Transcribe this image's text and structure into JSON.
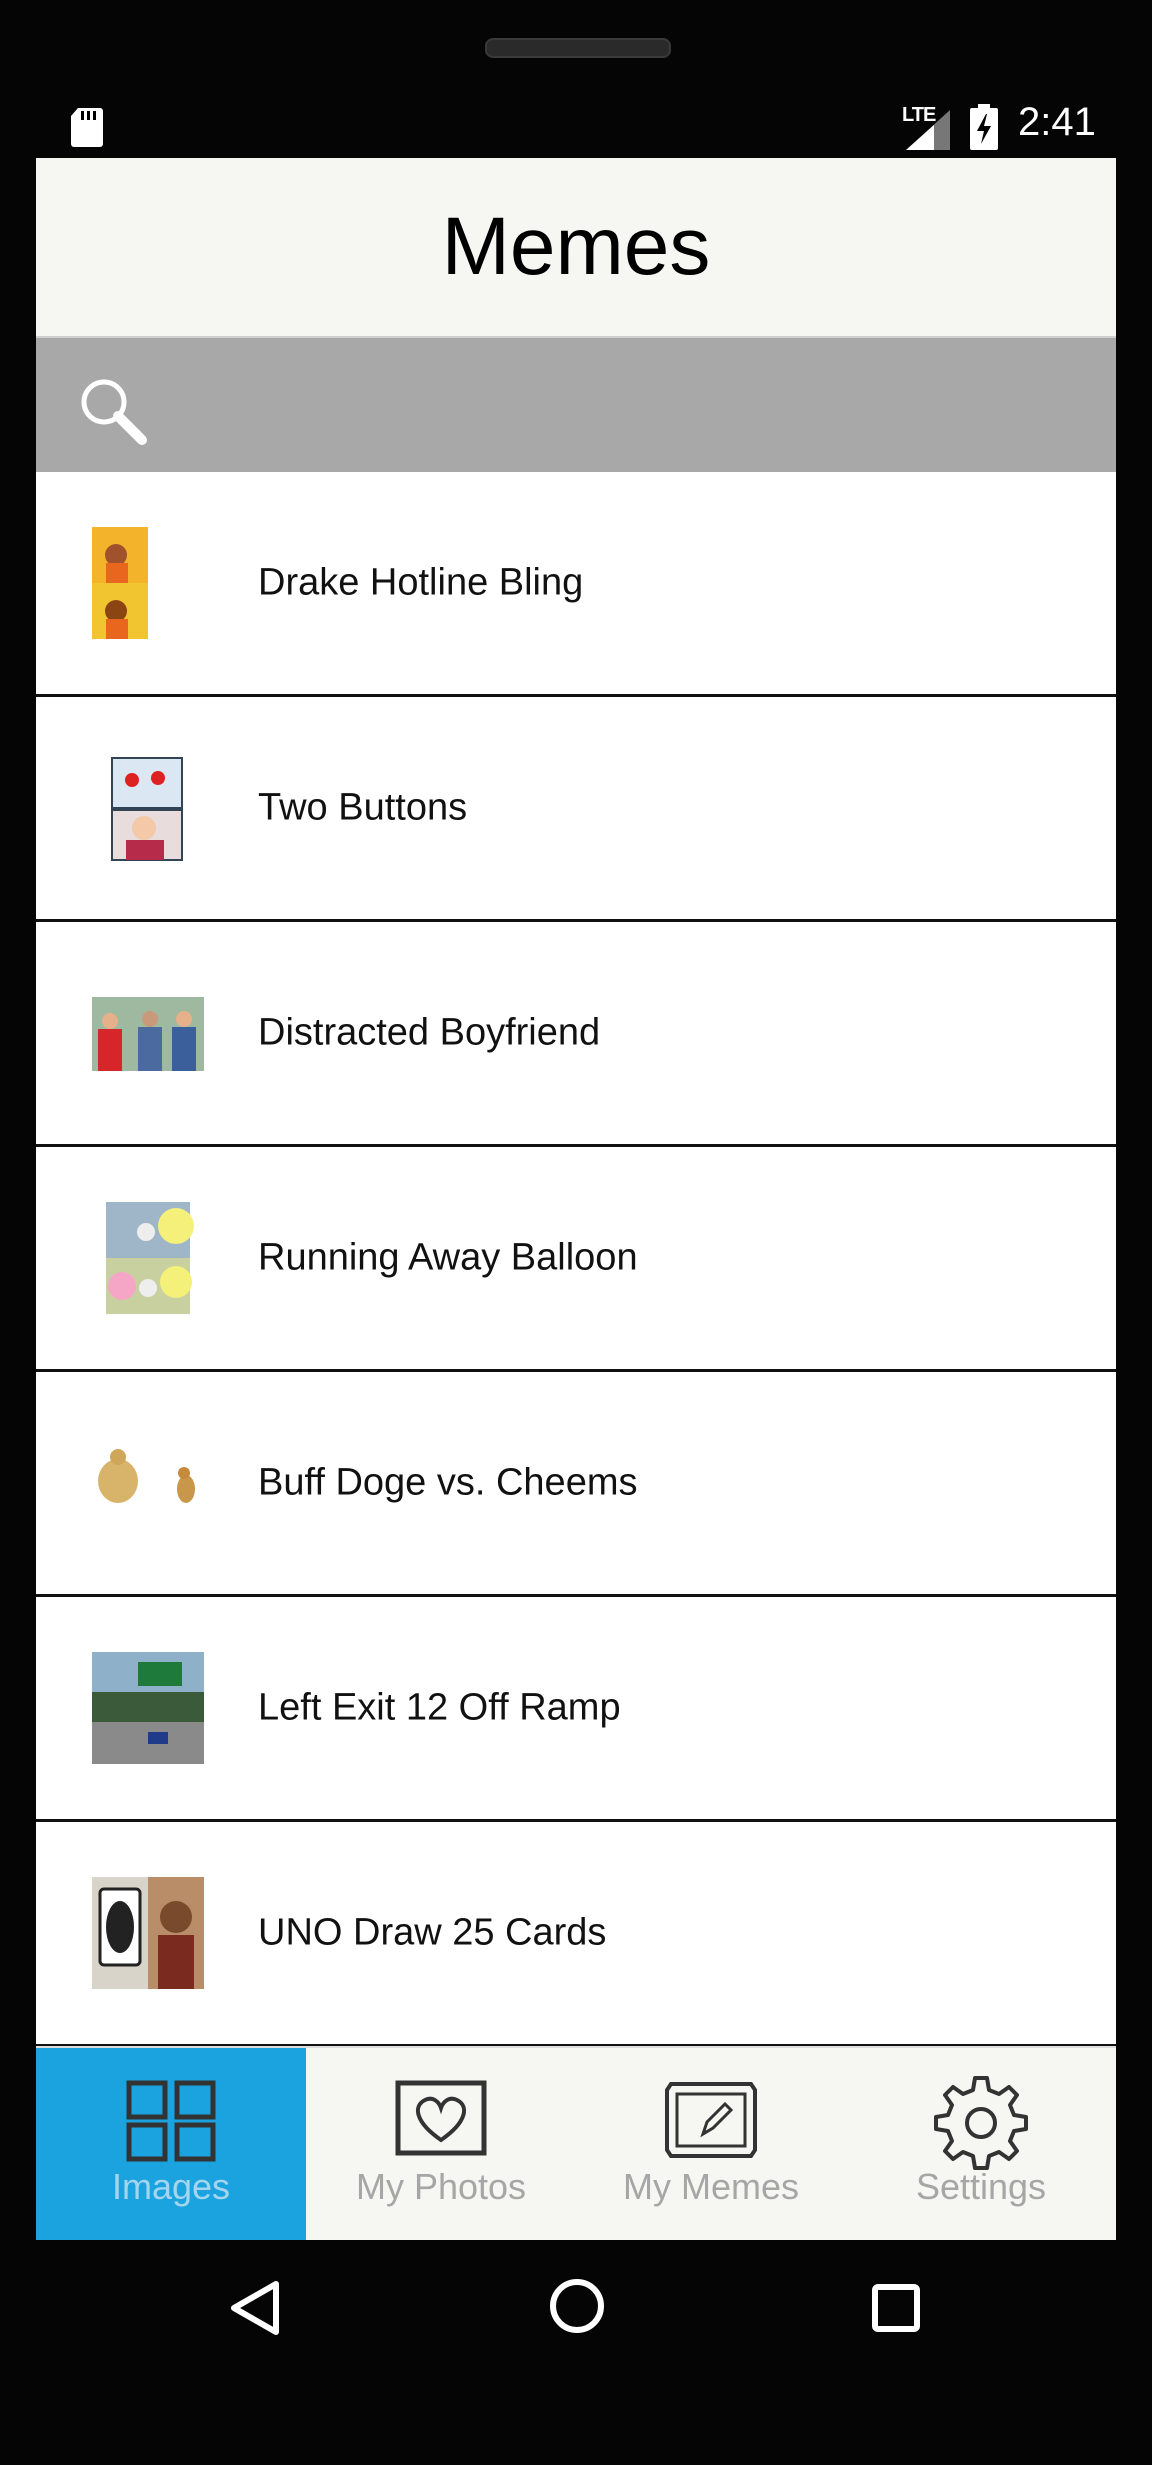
{
  "status_bar": {
    "time": "2:41",
    "network": "LTE"
  },
  "header": {
    "title": "Memes"
  },
  "search": {
    "placeholder": ""
  },
  "memes": [
    {
      "label": "Drake Hotline Bling"
    },
    {
      "label": "Two Buttons"
    },
    {
      "label": "Distracted Boyfriend"
    },
    {
      "label": "Running Away Balloon"
    },
    {
      "label": "Buff Doge vs. Cheems"
    },
    {
      "label": "Left Exit 12 Off Ramp"
    },
    {
      "label": "UNO Draw 25 Cards"
    }
  ],
  "tabs": [
    {
      "label": "Images",
      "icon": "grid-icon",
      "active": true
    },
    {
      "label": "My Photos",
      "icon": "heart-frame-icon",
      "active": false
    },
    {
      "label": "My Memes",
      "icon": "pencil-frame-icon",
      "active": false
    },
    {
      "label": "Settings",
      "icon": "gear-icon",
      "active": false
    }
  ],
  "colors": {
    "accent": "#1AA3DF",
    "search_bg": "#A8A8A8",
    "header_bg": "#F6F6F3"
  }
}
